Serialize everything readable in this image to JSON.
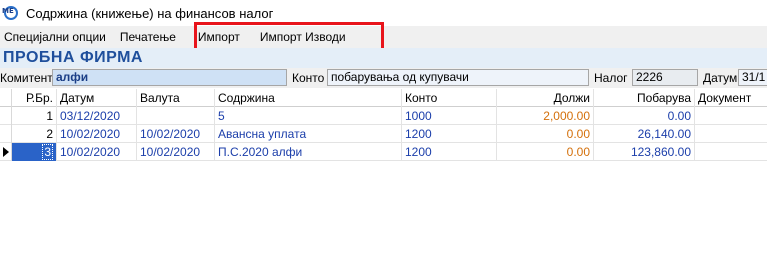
{
  "window": {
    "title": "Содржина (книжење) на финансов налог",
    "icon_text": "МЕ"
  },
  "menu": [
    {
      "label": "Специјални опции"
    },
    {
      "label": "Печатење"
    },
    {
      "label": "Импорт"
    },
    {
      "label": "Импорт Изводи"
    }
  ],
  "firm": {
    "name": "ПРОБНА ФИРМА"
  },
  "form": {
    "komitent_label": "Комитент",
    "komitent_value": "алфи",
    "konto_label": "Конто",
    "konto_value": "побарувања од купувачи",
    "nalog_label": "Налог",
    "nalog_value": "2226",
    "datum_label": "Датум",
    "datum_value": "31/1"
  },
  "table": {
    "headers": {
      "rb": "Р.Бр.",
      "datum": "Датум",
      "valuta": "Валута",
      "sodrzina": "Содржина",
      "konto": "Конто",
      "dolzi": "Должи",
      "pobaruva": "Побарува",
      "dokument": "Документ"
    },
    "rows": [
      {
        "rb": "1",
        "datum": "03/12/2020",
        "valuta": "",
        "sodrzina": "5",
        "konto": "1000",
        "dolzi": "2,000.00",
        "pobaruva": "0.00",
        "dokument": ""
      },
      {
        "rb": "2",
        "datum": "10/02/2020",
        "valuta": "10/02/2020",
        "sodrzina": "Авансна уплата",
        "konto": "1200",
        "dolzi": "0.00",
        "pobaruva": "26,140.00",
        "dokument": ""
      },
      {
        "rb": "3",
        "datum": "10/02/2020",
        "valuta": "10/02/2020",
        "sodrzina": "П.С.2020 алфи",
        "konto": "1200",
        "dolzi": "0.00",
        "pobaruva": "123,860.00",
        "dokument": ""
      }
    ]
  },
  "colors": {
    "firm_text": "#1f4f9c",
    "highlight_box": "#e8141b",
    "amount_dolzi": "#d4700b",
    "amount_pobaruva": "#1b3eaa"
  }
}
